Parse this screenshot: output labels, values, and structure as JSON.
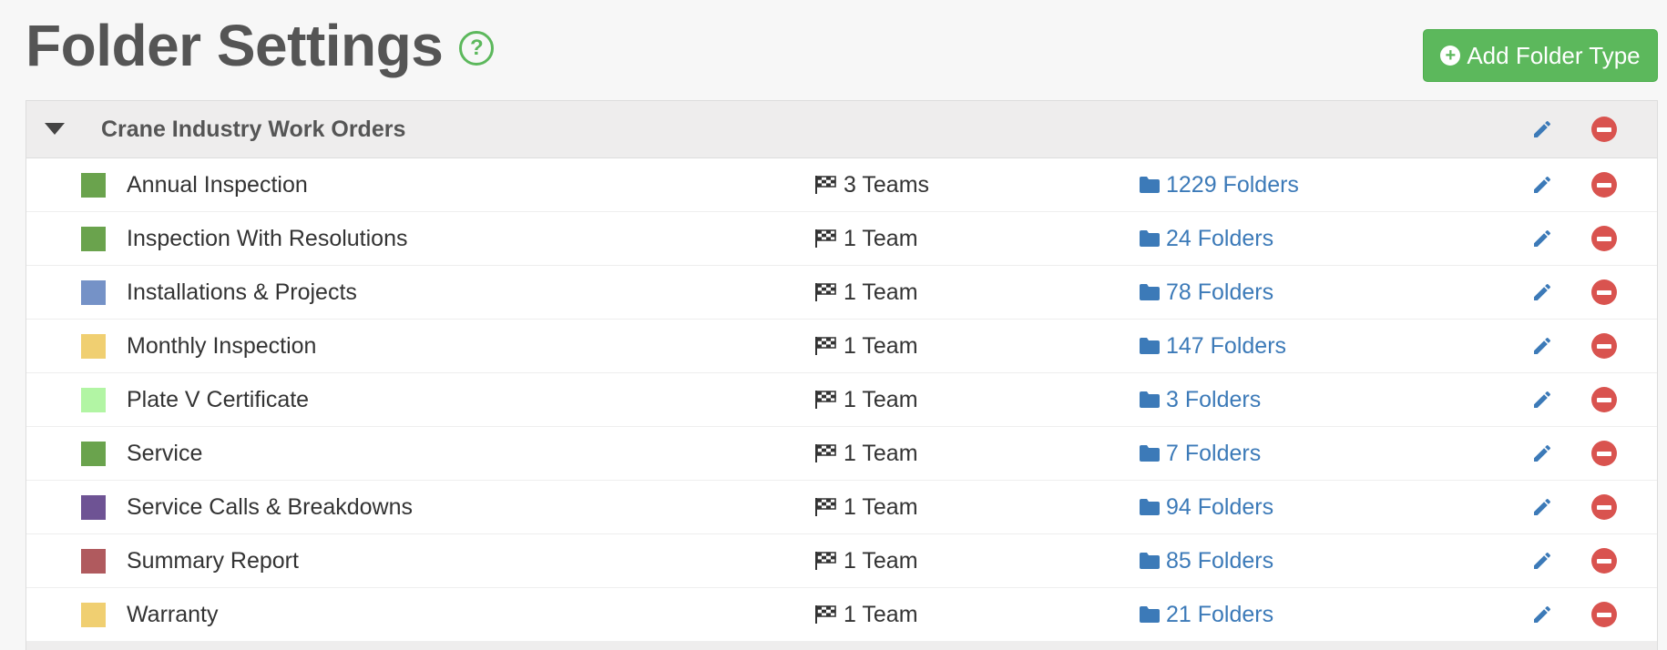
{
  "header": {
    "title": "Folder Settings",
    "help_label": "?",
    "add_button_label": "Add Folder Type"
  },
  "group": {
    "title": "Crane Industry Work Orders"
  },
  "colors": {
    "accent_green": "#5cb85c",
    "link_blue": "#3c7ab8",
    "delete_red": "#d9534f"
  },
  "rows": [
    {
      "name": "Annual Inspection",
      "color": "#6aa34d",
      "teams": "3 Teams",
      "folders": "1229 Folders"
    },
    {
      "name": "Inspection With Resolutions",
      "color": "#6aa34d",
      "teams": "1 Team",
      "folders": "24 Folders"
    },
    {
      "name": "Installations & Projects",
      "color": "#7592c7",
      "teams": "1 Team",
      "folders": "78 Folders"
    },
    {
      "name": "Monthly Inspection",
      "color": "#f0cf71",
      "teams": "1 Team",
      "folders": "147 Folders"
    },
    {
      "name": "Plate V Certificate",
      "color": "#b2f5a4",
      "teams": "1 Team",
      "folders": "3 Folders"
    },
    {
      "name": "Service",
      "color": "#6aa34d",
      "teams": "1 Team",
      "folders": "7 Folders"
    },
    {
      "name": "Service Calls & Breakdowns",
      "color": "#6e5394",
      "teams": "1 Team",
      "folders": "94 Folders"
    },
    {
      "name": "Summary Report",
      "color": "#b05a5e",
      "teams": "1 Team",
      "folders": "85 Folders"
    },
    {
      "name": "Warranty",
      "color": "#f0cf71",
      "teams": "1 Team",
      "folders": "21 Folders"
    }
  ]
}
